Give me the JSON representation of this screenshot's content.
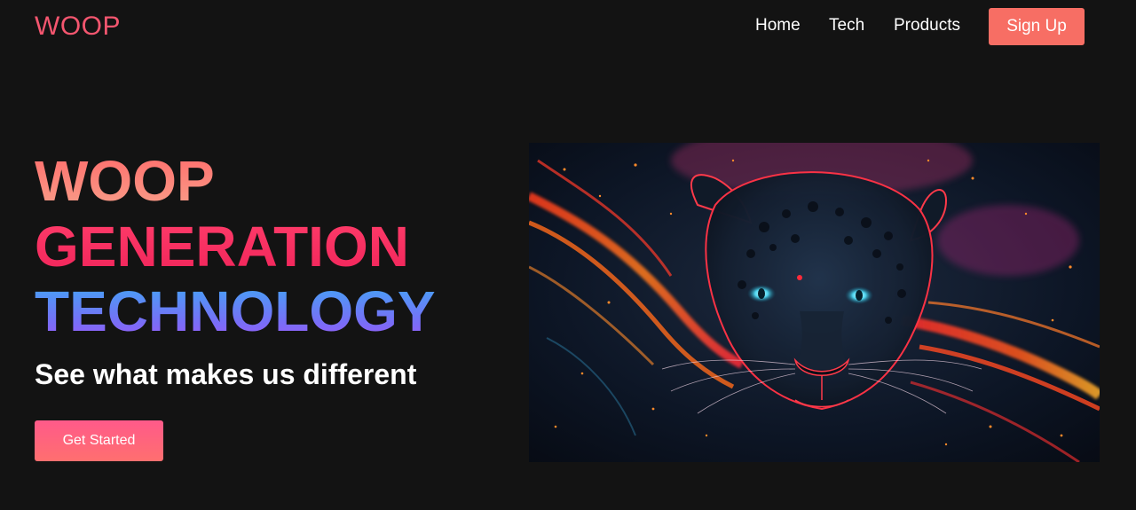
{
  "brand": {
    "logo_text": "WOOP"
  },
  "nav": {
    "links": [
      {
        "label": "Home"
      },
      {
        "label": "Tech"
      },
      {
        "label": "Products"
      }
    ],
    "signup_label": "Sign Up"
  },
  "hero": {
    "headline": [
      "WOOP",
      "GENERATION",
      "TECHNOLOGY"
    ],
    "tagline": "See what makes us different",
    "cta_label": "Get Started",
    "image": {
      "subject": "panther-face-neon-art"
    }
  },
  "colors": {
    "background": "#131313",
    "brand": "#f4566f",
    "signup": "#f76e64",
    "cta_start": "#ff5a8a",
    "cta_end": "#ff6f6f"
  }
}
